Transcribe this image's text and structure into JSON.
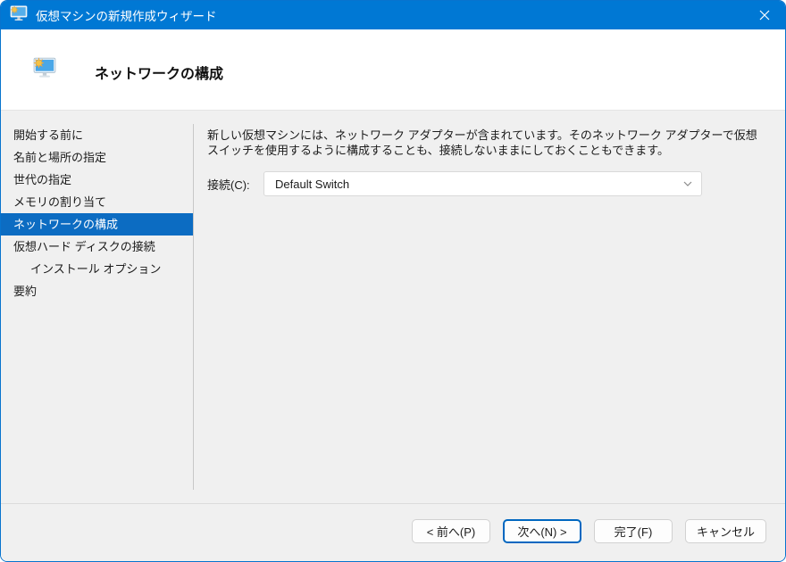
{
  "window": {
    "title": "仮想マシンの新規作成ウィザード"
  },
  "header": {
    "title": "ネットワークの構成"
  },
  "sidebar": {
    "items": [
      {
        "label": "開始する前に",
        "selected": false,
        "indent": false
      },
      {
        "label": "名前と場所の指定",
        "selected": false,
        "indent": false
      },
      {
        "label": "世代の指定",
        "selected": false,
        "indent": false
      },
      {
        "label": "メモリの割り当て",
        "selected": false,
        "indent": false
      },
      {
        "label": "ネットワークの構成",
        "selected": true,
        "indent": false
      },
      {
        "label": "仮想ハード ディスクの接続",
        "selected": false,
        "indent": false
      },
      {
        "label": "インストール オプション",
        "selected": false,
        "indent": true
      },
      {
        "label": "要約",
        "selected": false,
        "indent": false
      }
    ]
  },
  "content": {
    "description": "新しい仮想マシンには、ネットワーク アダプターが含まれています。そのネットワーク アダプターで仮想スイッチを使用するように構成することも、接続しないままにしておくこともできます。",
    "connection_label": "接続(C):",
    "connection_value": "Default Switch"
  },
  "footer": {
    "buttons": [
      {
        "label": "< 前へ(P)",
        "default": false
      },
      {
        "label": "次へ(N) >",
        "default": true
      },
      {
        "label": "完了(F)",
        "default": false
      },
      {
        "label": "キャンセル",
        "default": false
      }
    ]
  },
  "icons": {
    "app": "vm-monitor-with-sparkle",
    "close": "x-mark",
    "combo_chevron": "chevron-down"
  },
  "colors": {
    "titlebar": "#0078d4",
    "selection": "#0c6cc2",
    "default_button_border": "#0067c0",
    "window_border": "#0874ce",
    "header_bg": "#ffffff",
    "body_bg": "#f0f0f0"
  }
}
